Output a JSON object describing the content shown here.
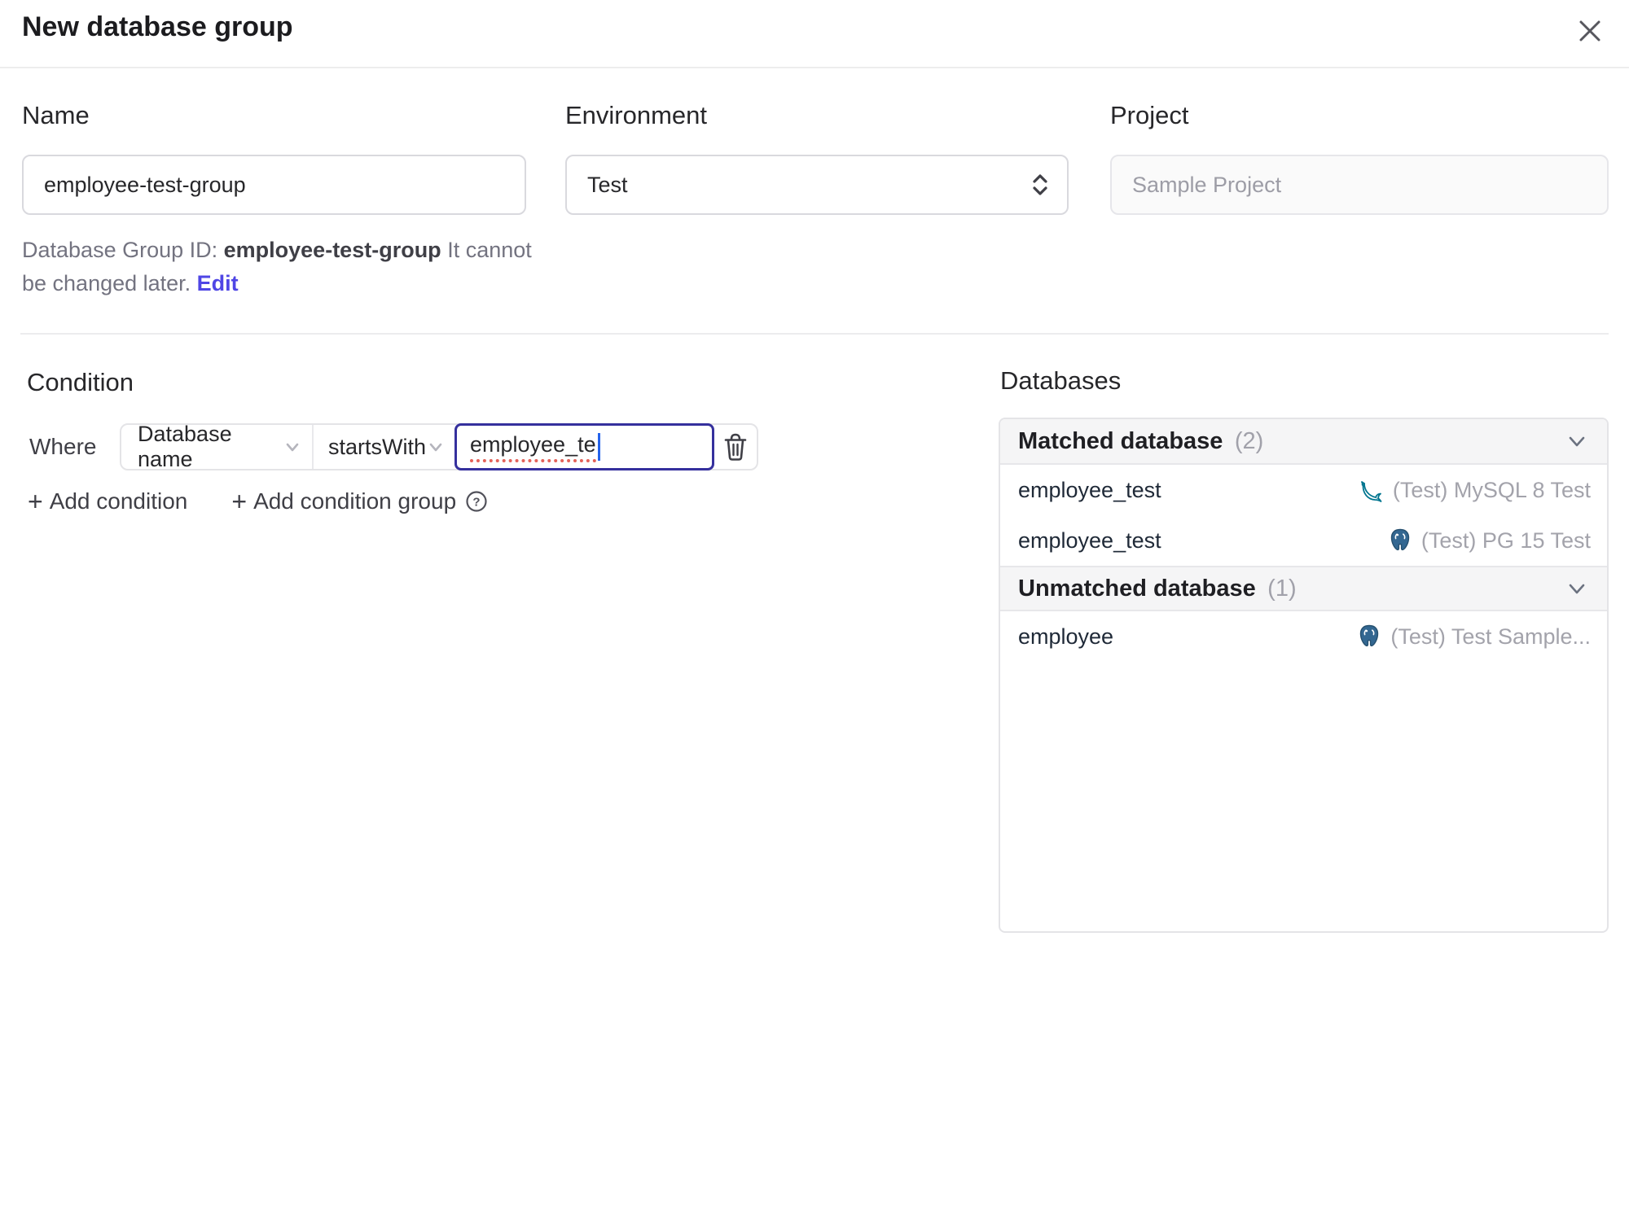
{
  "dialog": {
    "title": "New database group"
  },
  "form": {
    "name": {
      "label": "Name",
      "value": "employee-test-group"
    },
    "environment": {
      "label": "Environment",
      "value": "Test"
    },
    "project": {
      "label": "Project",
      "value": "Sample Project"
    },
    "id_note": {
      "prefix": "Database Group ID: ",
      "id": "employee-test-group",
      "suffix": " It cannot be changed later. ",
      "edit_label": "Edit"
    }
  },
  "condition": {
    "heading": "Condition",
    "where_label": "Where",
    "field": "Database name",
    "operator": "startsWith",
    "value": "employee_te",
    "add_condition_label": "Add condition",
    "add_condition_group_label": "Add condition group",
    "plus_glyph": "+",
    "help_glyph": "?"
  },
  "databases": {
    "heading": "Databases",
    "groups": [
      {
        "title": "Matched database",
        "count": "(2)",
        "rows": [
          {
            "name": "employee_test",
            "engine": "mysql-icon",
            "instance": "(Test) MySQL 8 Test"
          },
          {
            "name": "employee_test",
            "engine": "postgresql-icon",
            "instance": "(Test) PG 15 Test"
          }
        ]
      },
      {
        "title": "Unmatched database",
        "count": "(1)",
        "rows": [
          {
            "name": "employee",
            "engine": "postgresql-icon",
            "instance": "(Test) Test Sample..."
          }
        ]
      }
    ]
  },
  "colors": {
    "accent": "#4f46e5",
    "focus_border": "#35309d",
    "spellcheck_underline": "#e4635a",
    "mysql_icon": "#00758f",
    "postgres_icon": "#336791",
    "header_bg": "#f5f5f6",
    "muted_text": "#a1a1aa"
  }
}
